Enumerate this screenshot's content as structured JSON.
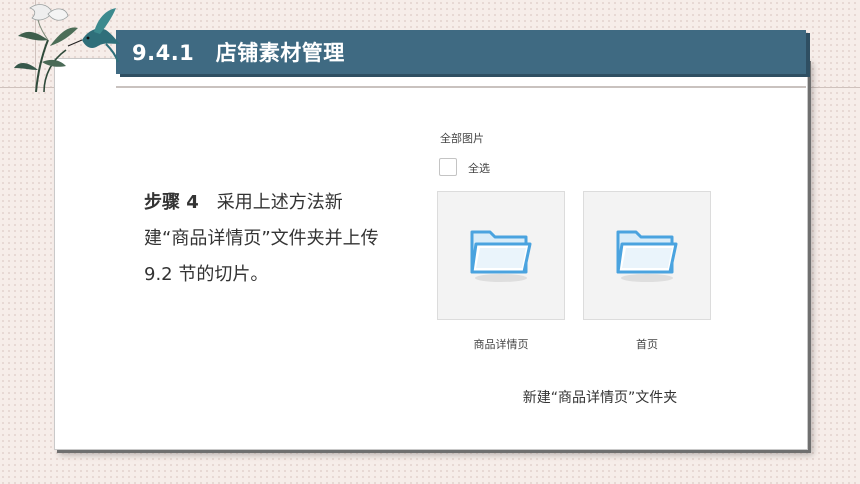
{
  "header": {
    "title": "9.4.1　店铺素材管理"
  },
  "body": {
    "step_label": "步骤 4",
    "step_text": "　采用上述方法新建“商品详情页”文件夹并上传 9.2 节的切片。"
  },
  "screenshot": {
    "section_title": "全部图片",
    "select_all_label": "全选",
    "folders": [
      {
        "label": "商品详情页"
      },
      {
        "label": "首页"
      }
    ]
  },
  "caption": "新建“商品详情页”文件夹",
  "colors": {
    "title_bar": "#3f6a82",
    "background": "#f6ede9",
    "folder_blue": "#4aa3df"
  }
}
